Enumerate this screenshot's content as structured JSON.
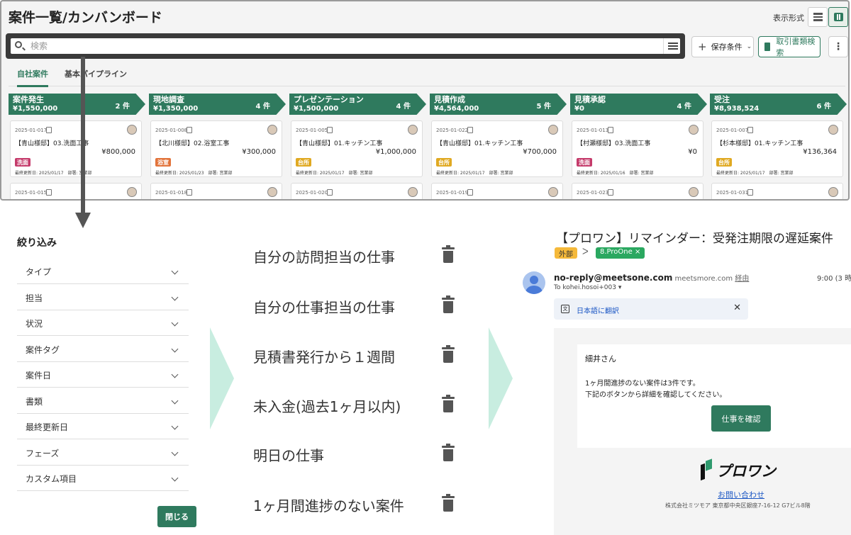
{
  "app": {
    "title": "案件一覧/カンバンボード",
    "view_label": "表示形式",
    "search_placeholder": "検索",
    "save_conditions_label": "保存条件",
    "doc_search_label": "取引書類検索",
    "more_label": "⋮",
    "tabs": [
      {
        "label": "自社案件",
        "active": true
      },
      {
        "label": "基本パイプライン",
        "active": false
      }
    ],
    "columns": [
      {
        "name": "案件発生",
        "total": "¥1,550,000",
        "count": "2 件",
        "card": {
          "date": "2025-01-017",
          "title": "【青山様邸】03.洗面工事",
          "amount": "¥800,000",
          "tag": "洗面",
          "tag_color": "#c53b6b",
          "meta": "最終更新日: 2025/01/17　部署: 営業部"
        },
        "card2_date": "2025-01-015"
      },
      {
        "name": "現地調査",
        "total": "¥1,350,000",
        "count": "4 件",
        "card": {
          "date": "2025-01-008",
          "title": "【北川様邸】02.浴室工事",
          "amount": "¥300,000",
          "tag": "浴室",
          "tag_color": "#e2733a",
          "meta": "最終更新日: 2025/01/23　部署: 営業部"
        },
        "card2_date": "2025-01-018"
      },
      {
        "name": "プレゼンテーション",
        "total": "¥1,500,000",
        "count": "4 件",
        "card": {
          "date": "2025-01-005",
          "title": "【青山様邸】01.キッチン工事",
          "amount": "¥1,000,000",
          "tag": "台所",
          "tag_color": "#e0a922",
          "meta": "最終更新日: 2025/01/17　部署: 営業部"
        },
        "card2_date": "2025-01-020"
      },
      {
        "name": "見積作成",
        "total": "¥4,564,000",
        "count": "5 件",
        "card": {
          "date": "2025-01-022",
          "title": "【青山様邸】01.キッチン工事",
          "amount": "¥700,000",
          "tag": "台所",
          "tag_color": "#e0a922",
          "meta": "最終更新日: 2025/01/17　部署: 営業部"
        },
        "card2_date": "2025-01-019"
      },
      {
        "name": "見積承認",
        "total": "¥0",
        "count": "4 件",
        "card": {
          "date": "2025-01-013",
          "title": "【村瀬様邸】03.洗面工事",
          "amount": "¥0",
          "tag": "洗面",
          "tag_color": "#c53b6b",
          "meta": "最終更新日: 2025/01/16　部署: 営業部"
        },
        "card2_date": "2025-01-023"
      },
      {
        "name": "受注",
        "total": "¥8,938,524",
        "count": "6 件",
        "card": {
          "date": "2025-01-007",
          "title": "【杉本様邸】01.キッチン工事",
          "amount": "¥136,364",
          "tag": "台所",
          "tag_color": "#e0a922",
          "meta": "最終更新日: 2025/01/17　部署: 営業部"
        },
        "card2_date": "2025-01-031"
      }
    ]
  },
  "filter": {
    "title": "絞り込み",
    "items": [
      "タイプ",
      "担当",
      "状況",
      "案件タグ",
      "案件日",
      "書類",
      "最終更新日",
      "フェーズ",
      "カスタム項目"
    ],
    "close_label": "閉じる"
  },
  "saved_conditions": [
    "自分の訪問担当の仕事",
    "自分の仕事担当の仕事",
    "見積書発行から１週間",
    "未入金(過去1ヶ月以内)",
    "明日の仕事",
    "1ヶ月間進捗のない案件"
  ],
  "email": {
    "subject": "【プロワン】リマインダー：受発注期限の遅延案件",
    "tag_external": "外部",
    "tag_proone": "8.ProOne ×",
    "sender_email": "no-reply@meetsone.com",
    "sender_via": " meetsmore.com ",
    "sender_via_link": "経由",
    "time": "9:00 (3 時",
    "to": "To kohei.hosoi+003 ▾",
    "translate": "日本語に翻訳",
    "greeting": "細井さん",
    "body_line1": "1ヶ月間進捗のない案件は3件です。",
    "body_line2": "下記のボタンから詳細を確認してください。",
    "button": "仕事を確認",
    "logo_text": "プロワン",
    "contact": "お問い合わせ",
    "company": "株式会社ミツモア 東京都中央区銀座7-16-12 G7ビル8階"
  },
  "colors": {
    "brand": "#2f7a5e",
    "chevron": "#c8ede0"
  }
}
